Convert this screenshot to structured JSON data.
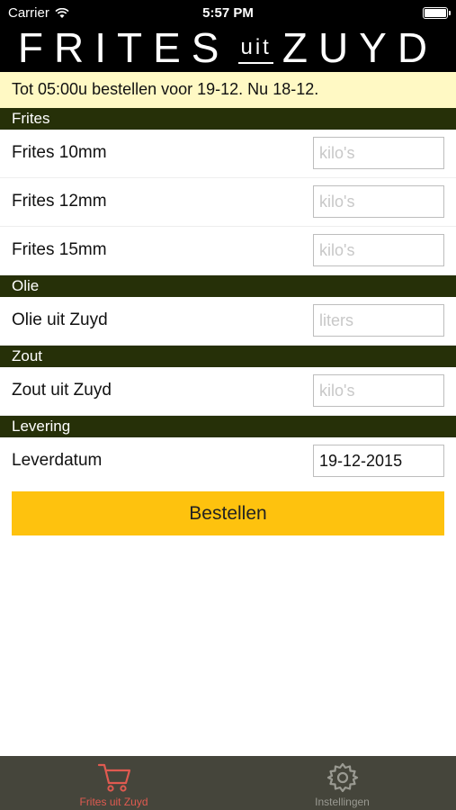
{
  "status_bar": {
    "carrier": "Carrier",
    "time": "5:57 PM"
  },
  "header": {
    "logo_left": "FRITES",
    "logo_middle": "uit",
    "logo_right": "ZUYD"
  },
  "notice": "Tot 05:00u bestellen voor 19-12. Nu 18-12.",
  "sections": {
    "frites": {
      "title": "Frites",
      "items": [
        {
          "label": "Frites 10mm",
          "placeholder": "kilo's"
        },
        {
          "label": "Frites 12mm",
          "placeholder": "kilo's"
        },
        {
          "label": "Frites 15mm",
          "placeholder": "kilo's"
        }
      ]
    },
    "olie": {
      "title": "Olie",
      "items": [
        {
          "label": "Olie uit Zuyd",
          "placeholder": "liters"
        }
      ]
    },
    "zout": {
      "title": "Zout",
      "items": [
        {
          "label": "Zout uit Zuyd",
          "placeholder": "kilo's"
        }
      ]
    },
    "levering": {
      "title": "Levering",
      "items": [
        {
          "label": "Leverdatum",
          "value": "19-12-2015"
        }
      ]
    }
  },
  "order_button": "Bestellen",
  "tabs": [
    {
      "label": "Frites uit Zuyd",
      "icon": "cart-icon",
      "active": true,
      "color": "#e05a50"
    },
    {
      "label": "Instellingen",
      "icon": "gear-icon",
      "active": false,
      "color": "#9a9a92"
    }
  ],
  "colors": {
    "section_bg": "#263008",
    "notice_bg": "#fff9c4",
    "button_bg": "#fec20e",
    "tabbar_bg": "#45453b"
  }
}
